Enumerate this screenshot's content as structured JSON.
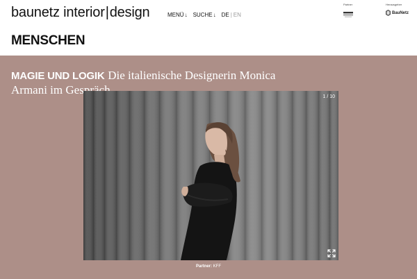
{
  "header": {
    "logo": {
      "part1": "baunetz",
      "part2": "interior",
      "sep": "|",
      "part3": "design"
    },
    "nav": [
      {
        "label": "MENÜ",
        "arrow": "↓"
      },
      {
        "label": "SUCHE",
        "arrow": "↓"
      }
    ],
    "languages": {
      "active": "DE",
      "sep": "|",
      "inactive": "EN"
    },
    "partner_label": "Partner",
    "publisher_label": "Herausgeber",
    "publisher_logo_text": "BauNetz"
  },
  "section": {
    "title": "MENSCHEN"
  },
  "feature": {
    "kicker": "MAGIE UND LOGIK",
    "title": "Die italienische Designerin Monica Armani im Gespräch",
    "gallery": {
      "counter": "1 / 10",
      "current": 1,
      "total": 10
    },
    "caption": {
      "label": "Partner:",
      "value": "KFF"
    }
  },
  "colors": {
    "panel": "#ad8f88",
    "background": "#ffffff",
    "text": "#111111",
    "lang_inactive": "#9a9a9a"
  },
  "icons": [
    "arrow-down-icon",
    "expand-icon",
    "partner-logo-icon",
    "baunetz-logo-icon"
  ]
}
